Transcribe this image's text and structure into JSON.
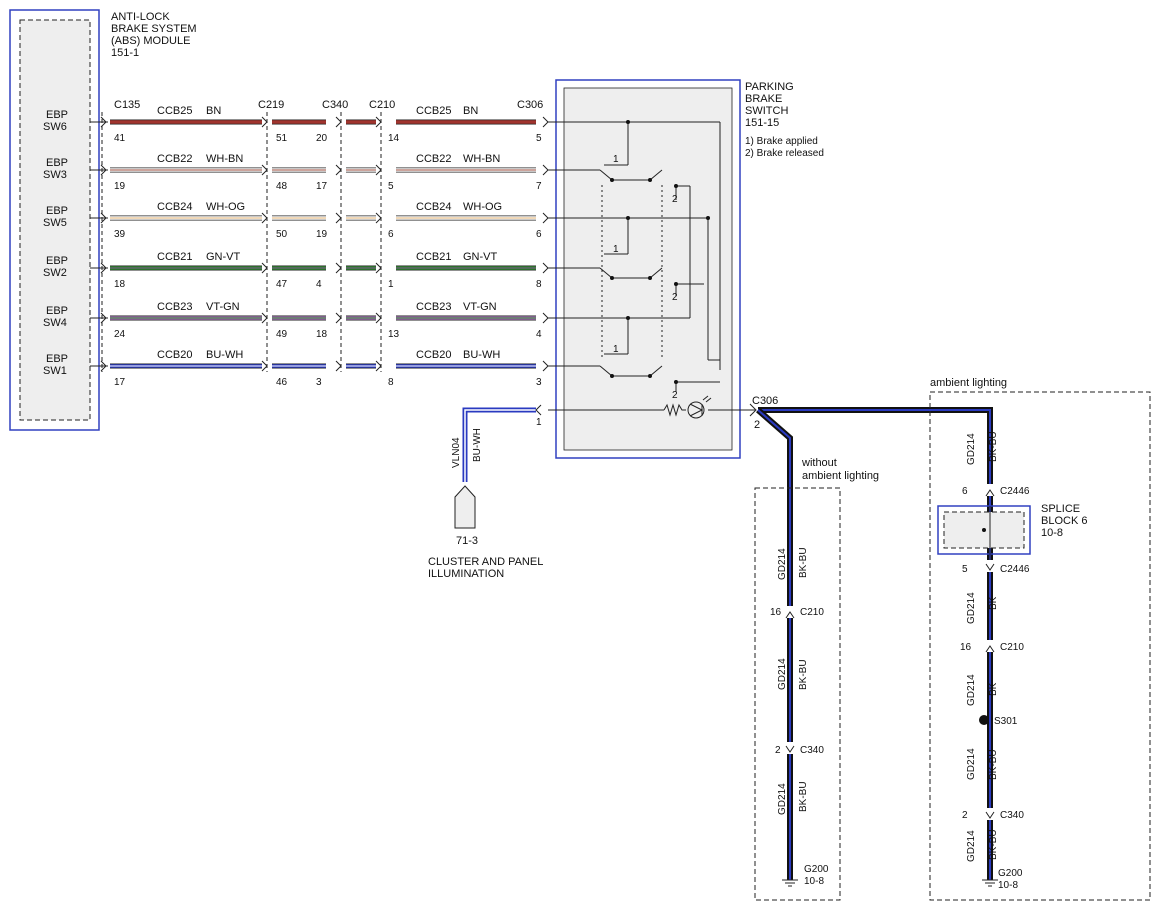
{
  "abs_module": {
    "title": [
      "ANTI-LOCK",
      "BRAKE SYSTEM",
      "(ABS) MODULE",
      "151-1"
    ]
  },
  "switch_block": {
    "title": [
      "PARKING",
      "BRAKE",
      "SWITCH",
      "151-15"
    ],
    "notes": [
      "1) Brake applied",
      "2) Brake released"
    ]
  },
  "connectors": {
    "c135": "C135",
    "c219": "C219",
    "c340": "C340",
    "c210": "C210",
    "c306": "C306"
  },
  "circuits": [
    {
      "pin": [
        "EBP",
        "SW6"
      ],
      "circuit": "CCB25",
      "color_label": "BN",
      "pins": [
        "41",
        "51",
        "20",
        "14",
        "5"
      ],
      "sw": "SW6",
      "wire_color": "#a0342e",
      "stripe": null
    },
    {
      "pin": [
        "EBP",
        "SW3"
      ],
      "circuit": "CCB22",
      "color_label": "WH-BN",
      "pins": [
        "19",
        "48",
        "17",
        "5",
        "7"
      ],
      "sw": "SW3",
      "wire_color": "#ffffff",
      "stripe": "#9a4a3a"
    },
    {
      "pin": [
        "EBP",
        "SW5"
      ],
      "circuit": "CCB24",
      "color_label": "WH-OG",
      "pins": [
        "39",
        "50",
        "19",
        "6",
        "6"
      ],
      "sw": "SW5",
      "wire_color": "#ffffff",
      "stripe": "#e0b070"
    },
    {
      "pin": [
        "EBP",
        "SW2"
      ],
      "circuit": "CCB21",
      "color_label": "GN-VT",
      "pins": [
        "18",
        "47",
        "4",
        "1",
        "8"
      ],
      "sw": "SW2",
      "wire_color": "#2f8a2f",
      "stripe": "#7a4a8a"
    },
    {
      "pin": [
        "EBP",
        "SW4"
      ],
      "circuit": "CCB23",
      "color_label": "VT-GN",
      "pins": [
        "24",
        "49",
        "18",
        "13",
        "4"
      ],
      "sw": "SW4",
      "wire_color": "#a070b0",
      "stripe": "#3a8a3a"
    },
    {
      "pin": [
        "EBP",
        "SW1"
      ],
      "circuit": "CCB20",
      "color_label": "BU-WH",
      "pins": [
        "17",
        "46",
        "3",
        "8",
        "3"
      ],
      "sw": "SW1",
      "wire_color": "#2a3ac0",
      "stripe": "#ffffff"
    }
  ],
  "switch_labels": {
    "one": "1",
    "two": "2"
  },
  "illumination": {
    "pin": "1",
    "circuit": "VLN04",
    "color_label": "BU-WH",
    "ref": "71-3",
    "title": [
      "CLUSTER AND PANEL",
      "ILLUMINATION"
    ]
  },
  "ground_c306": {
    "connector": "C306",
    "pin": "2"
  },
  "without_ambient": {
    "label": [
      "without",
      "ambient lighting"
    ],
    "wire1": {
      "circuit": "GD214",
      "color": "BK-BU"
    },
    "c210": {
      "name": "C210",
      "pin": "16"
    },
    "wire2": {
      "circuit": "GD214",
      "color": "BK-BU"
    },
    "c340": {
      "name": "C340",
      "pin": "2"
    },
    "wire3": {
      "circuit": "GD214",
      "color": "BK-BU"
    },
    "ground": {
      "name": "G200",
      "ref": "10-8"
    }
  },
  "ambient": {
    "label": "ambient lighting",
    "wire1": {
      "circuit": "GD214",
      "color": "BK-BU"
    },
    "c2446_top": {
      "name": "C2446",
      "pin": "6"
    },
    "splice": {
      "title": [
        "SPLICE",
        "BLOCK 6",
        "10-8"
      ]
    },
    "c2446_bot": {
      "name": "C2446",
      "pin": "5"
    },
    "wire2": {
      "circuit": "GD214",
      "color": "BK"
    },
    "c210": {
      "name": "C210",
      "pin": "16"
    },
    "wire3": {
      "circuit": "GD214",
      "color": "BK"
    },
    "s301": "S301",
    "wire4": {
      "circuit": "GD214",
      "color": "BK-BU"
    },
    "c340": {
      "name": "C340",
      "pin": "2"
    },
    "wire5": {
      "circuit": "GD214",
      "color": "BK-BU"
    },
    "ground": {
      "name": "G200",
      "ref": "10-8"
    }
  }
}
